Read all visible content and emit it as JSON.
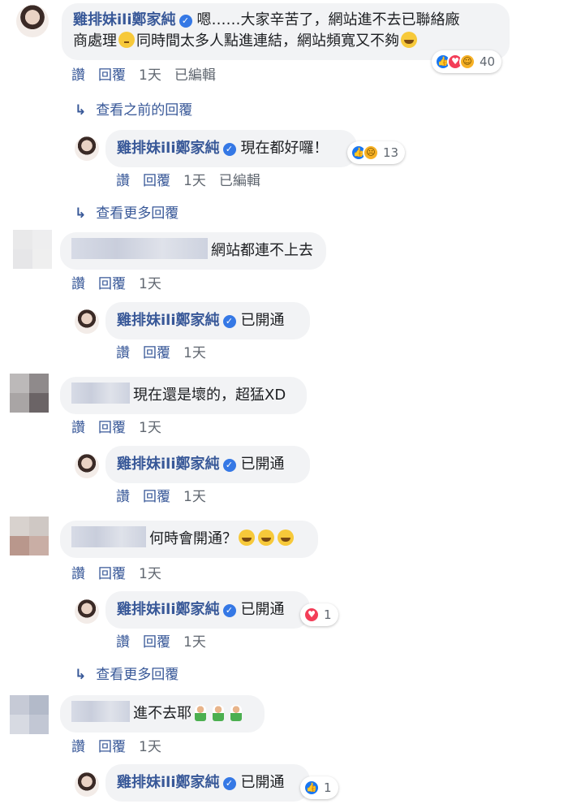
{
  "author_name": "雞排妹ili鄭家純",
  "actions": {
    "like": "讚",
    "reply": "回覆",
    "edited": "已編輯"
  },
  "comments": [
    {
      "text_line1": "嗯……大家辛苦了，網站進不去已聯絡廠",
      "text_line2": "商處理",
      "text_line2b": "同時間太多人點進連結，網站頻寬又不夠",
      "time": "1天",
      "reaction_count": "40",
      "see_previous": "查看之前的回覆",
      "reply": {
        "text": "現在都好囉！",
        "time": "1天",
        "reaction_count": "13"
      },
      "see_more": "查看更多回覆"
    },
    {
      "text": "網站都連不上去",
      "time": "1天",
      "reply": {
        "text": "已開通",
        "time": "1天"
      }
    },
    {
      "text": "現在還是壞的，超猛XD",
      "time": "1天",
      "reply": {
        "text": "已開通",
        "time": "1天"
      }
    },
    {
      "text": "何時會開通？",
      "time": "1天",
      "reply": {
        "text": "已開通",
        "time": "1天",
        "reaction_count": "1"
      },
      "see_more": "查看更多回覆"
    },
    {
      "text": "進不去耶",
      "time": "1天",
      "reply": {
        "text": "已開通",
        "reaction_count": "1"
      }
    }
  ],
  "colors": {
    "name_blue": "#385898",
    "bubble_bg": "#f2f3f5",
    "meta_gray": "#606770",
    "like_blue": "#1877f2",
    "love_red": "#f33e58"
  }
}
